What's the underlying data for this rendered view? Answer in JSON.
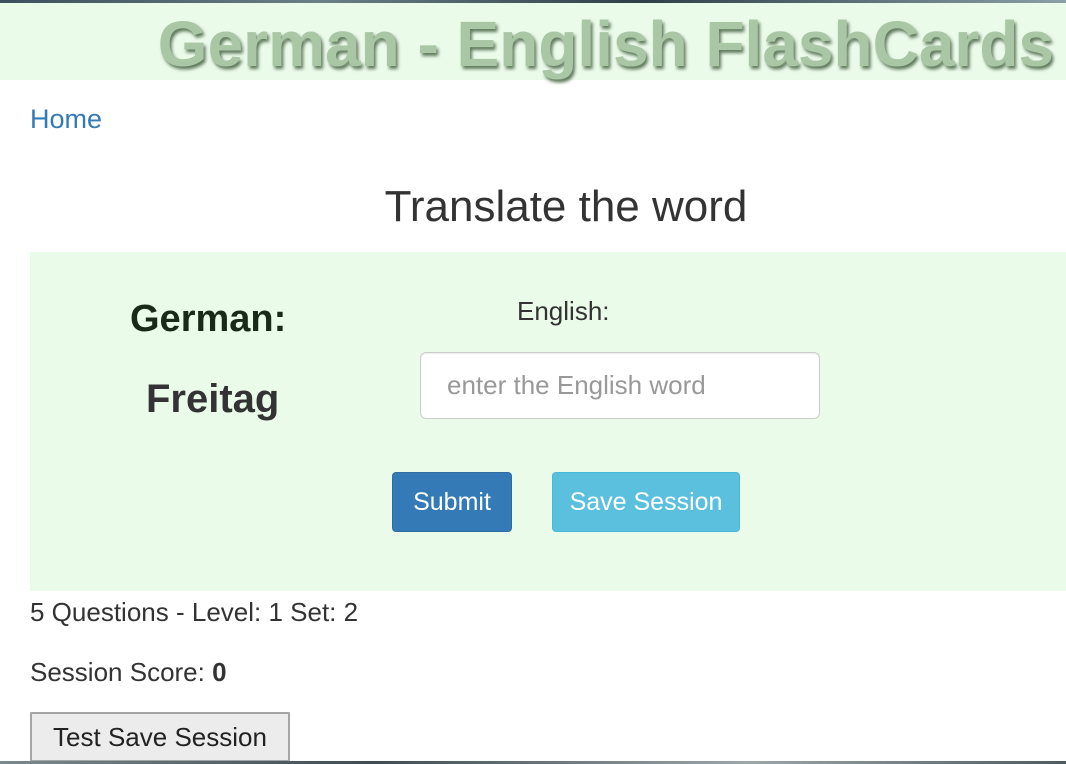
{
  "header": {
    "title": "German - English FlashCards"
  },
  "nav": {
    "home_label": "Home"
  },
  "main": {
    "title": "Translate the word",
    "card": {
      "german_label": "German:",
      "german_word": "Freitag",
      "english_label": "English:",
      "english_input": {
        "value": "",
        "placeholder": "enter the English word"
      },
      "submit_label": "Submit",
      "save_session_label": "Save Session"
    }
  },
  "session": {
    "info": "5 Questions - Level: 1 Set: 2",
    "score_label": "Session Score:",
    "score_value": "0",
    "test_save_label": "Test Save Session"
  },
  "colors": {
    "banner_background": "#ebfbea",
    "banner_text": "#a9c6a5",
    "link": "#337ab7",
    "primary_button": "#337ab7",
    "info_button": "#5bc0de"
  }
}
